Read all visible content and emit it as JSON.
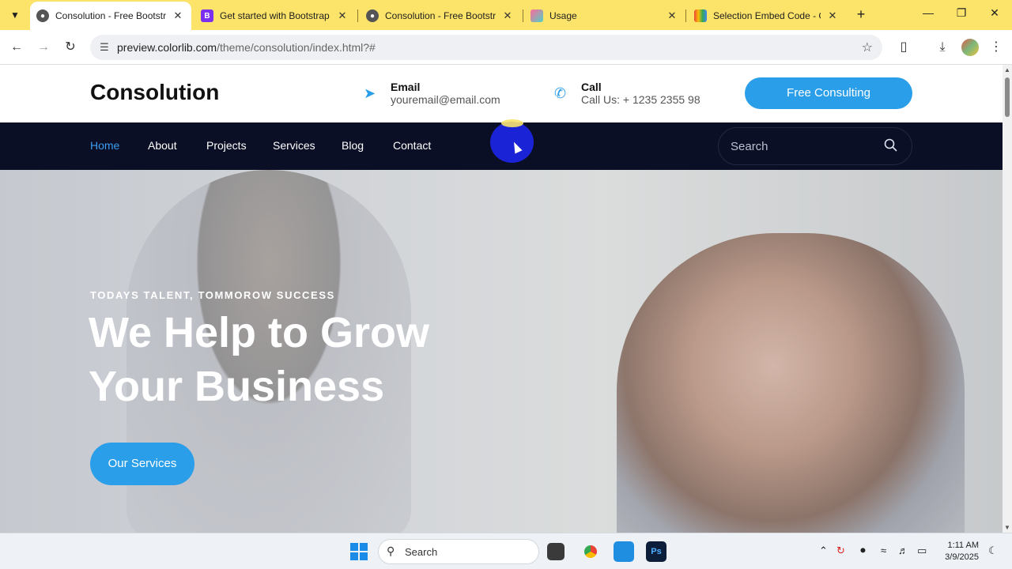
{
  "browser": {
    "tabs": [
      {
        "title": "Consolution - Free Bootstrap",
        "active": true,
        "favicon": "globe-icon"
      },
      {
        "title": "Get started with Bootstrap ·",
        "active": false,
        "favicon": "bootstrap-icon"
      },
      {
        "title": "Consolution - Free Bootstrap",
        "active": false,
        "favicon": "globe-icon"
      },
      {
        "title": "Usage",
        "active": false,
        "favicon": "cube-icon"
      },
      {
        "title": "Selection Embed Code - Go",
        "active": false,
        "favicon": "google-icon"
      }
    ],
    "url_domain": "preview.colorlib.com",
    "url_path": "/theme/consolution/index.html?#",
    "accent_color": "#fce36a"
  },
  "site": {
    "logo": "Consolution",
    "email_label": "Email",
    "email_value": "youremail@email.com",
    "call_label": "Call",
    "call_value": "Call Us: + 1235 2355 98",
    "cta_label": "Free Consulting",
    "nav": [
      "Home",
      "About",
      "Projects",
      "Services",
      "Blog",
      "Contact"
    ],
    "nav_active": "Home",
    "search_placeholder": "Search",
    "hero_subtitle": "TODAYS TALENT, TOMMOROW SUCCESS",
    "hero_title_line1": "We Help to Grow",
    "hero_title_line2": "Your Business",
    "hero_button": "Our Services",
    "brand_color": "#2a9ee8",
    "navbar_color": "#0b0f26"
  },
  "taskbar": {
    "search_placeholder": "Search",
    "time": "1:11 AM",
    "date": "3/9/2025"
  }
}
